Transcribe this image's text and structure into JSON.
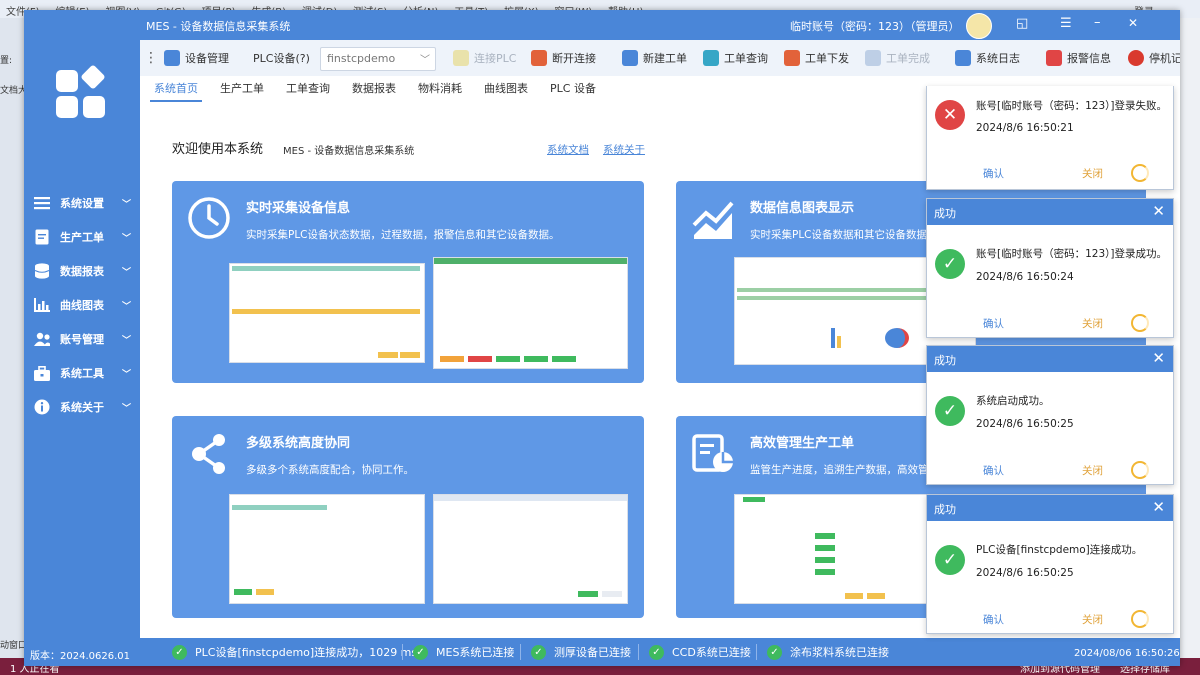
{
  "ide": {
    "menu": [
      "文件(F)",
      "编辑(E)",
      "视图(V)",
      "Git(G)",
      "项目(P)",
      "生成(B)",
      "调试(D)",
      "测试(S)",
      "分析(N)",
      "工具(T)",
      "扩展(X)",
      "窗口(W)",
      "帮助(H)"
    ],
    "login_label": "登录",
    "bottom_version": "版本：2024.0626.01",
    "bottom_left": "1 人正在看",
    "bottom_add_source": "添加到源代码管理",
    "bottom_repo": "选择存储库",
    "left_labels": [
      "文件(F)",
      "置:",
      "文档大",
      "动窗口"
    ]
  },
  "window": {
    "title": "MES - 设备数据信息采集系统",
    "account": "临时账号（密码：123）（管理员）",
    "controls": [
      "◱",
      "☰",
      "–",
      "✕"
    ]
  },
  "toolbar": {
    "items": [
      {
        "name": "device-manage-button",
        "label": "设备管理",
        "icon": "device-icon",
        "enabled": true
      },
      {
        "name": "plc-device-label",
        "label": "PLC设备(?)",
        "icon": "",
        "enabled": true
      },
      {
        "name": "plc-select",
        "label": "finstcpdemo",
        "icon": "",
        "enabled": true
      },
      {
        "name": "connect-plc-button",
        "label": "连接PLC",
        "icon": "link-icon",
        "enabled": false
      },
      {
        "name": "disconnect-button",
        "label": "断开连接",
        "icon": "unlink-icon",
        "enabled": true
      },
      {
        "name": "new-work-order-button",
        "label": "新建工单",
        "icon": "new-doc-icon",
        "enabled": true
      },
      {
        "name": "query-work-order-button",
        "label": "工单查询",
        "icon": "search-doc-icon",
        "enabled": true
      },
      {
        "name": "dispatch-work-order-button",
        "label": "工单下发",
        "icon": "dispatch-icon",
        "enabled": true
      },
      {
        "name": "complete-work-order-button",
        "label": "工单完成",
        "icon": "done-icon",
        "enabled": false
      },
      {
        "name": "system-log-button",
        "label": "系统日志",
        "icon": "log-icon",
        "enabled": true
      },
      {
        "name": "alarm-info-button",
        "label": "报警信息",
        "icon": "alarm-icon",
        "enabled": true
      },
      {
        "name": "stop-machine-button",
        "label": "停机记",
        "icon": "stop-icon",
        "enabled": true
      }
    ]
  },
  "sidebar": {
    "items": [
      {
        "label": "系统设置",
        "icon": "menu-icon"
      },
      {
        "label": "生产工单",
        "icon": "doc-icon"
      },
      {
        "label": "数据报表",
        "icon": "database-icon"
      },
      {
        "label": "曲线图表",
        "icon": "chart-icon"
      },
      {
        "label": "账号管理",
        "icon": "users-icon"
      },
      {
        "label": "系统工具",
        "icon": "toolbox-icon"
      },
      {
        "label": "系统关于",
        "icon": "info-icon"
      }
    ]
  },
  "tabs": [
    "系统首页",
    "生产工单",
    "工单查询",
    "数据报表",
    "物料消耗",
    "曲线图表",
    "PLC 设备"
  ],
  "home": {
    "welcome": "欢迎使用本系统",
    "subtitle": "MES - 设备数据信息采集系统",
    "link_docs": "系统文档",
    "link_about": "系统关于",
    "cards": [
      {
        "title": "实时采集设备信息",
        "desc": "实时采集PLC设备状态数据，过程数据，报警信息和其它设备数据。",
        "icon": "clock-icon"
      },
      {
        "title": "数据信息图表显示",
        "desc": "实时采集PLC设备数据和其它设备数据，",
        "icon": "trend-chart-icon"
      },
      {
        "title": "多级系统高度协同",
        "desc": "多级多个系统高度配合，协同工作。",
        "icon": "share-icon"
      },
      {
        "title": "高效管理生产工单",
        "desc": "监管生产进度，追溯生产数据，高效管理",
        "icon": "report-icon"
      }
    ]
  },
  "statusbar": {
    "version": "版本：2024.0626.01",
    "items": [
      "PLC设备[finstcpdemo]连接成功，1029 ms",
      "MES系统已连接",
      "测厚设备已连接",
      "CCD系统已连接",
      "涂布浆料系统已连接"
    ],
    "datetime": "2024/08/06 16:50:26"
  },
  "toasts": [
    {
      "type": "error",
      "title": "",
      "message": "账号[临时账号（密码：123）]登录失败。",
      "time": "2024/8/6 16:50:21",
      "confirm": "确认",
      "close": "关闭"
    },
    {
      "type": "success",
      "title": "成功",
      "message": "账号[临时账号（密码：123）]登录成功。",
      "time": "2024/8/6 16:50:24",
      "confirm": "确认",
      "close": "关闭"
    },
    {
      "type": "success",
      "title": "成功",
      "message": "系统启动成功。",
      "time": "2024/8/6 16:50:25",
      "confirm": "确认",
      "close": "关闭"
    },
    {
      "type": "success",
      "title": "成功",
      "message": "PLC设备[finstcpdemo]连接成功。",
      "time": "2024/8/6 16:50:25",
      "confirm": "确认",
      "close": "关闭"
    }
  ],
  "colors": {
    "primary": "#4a86d8",
    "card": "#5f98e6",
    "success": "#3fba5e",
    "error": "#e04545",
    "warning": "#f2b633"
  }
}
